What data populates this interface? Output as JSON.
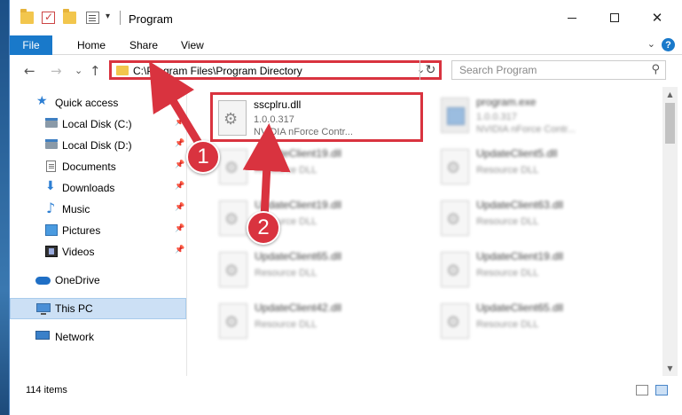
{
  "window": {
    "title": "Program",
    "controls": {
      "minimize": "—",
      "maximize": "☐",
      "close": "✕"
    }
  },
  "quick_access_toolbar": {
    "dropdown": "▾"
  },
  "ribbon": {
    "tabs": [
      "File",
      "Home",
      "Share",
      "View"
    ],
    "collapse_chevron": "⌄",
    "help": "?"
  },
  "navigation": {
    "back": "←",
    "forward": "→",
    "recent": "⌄",
    "up": "↑",
    "address": "C:\\Program Files\\Program Directory",
    "address_dropdown": "⌄",
    "refresh": "↻",
    "search_placeholder": "Search Program",
    "search_icon": "⚲"
  },
  "sidebar": {
    "pin_glyph": "📌",
    "items": [
      {
        "label": "Quick access",
        "icon": "star-icon",
        "pinned": false
      },
      {
        "label": "Local Disk (C:)",
        "icon": "drive-icon",
        "pinned": true
      },
      {
        "label": "Local Disk (D:)",
        "icon": "drive-icon",
        "pinned": true
      },
      {
        "label": "Documents",
        "icon": "documents-icon",
        "pinned": true
      },
      {
        "label": "Downloads",
        "icon": "downloads-icon",
        "pinned": true
      },
      {
        "label": "Music",
        "icon": "music-icon",
        "pinned": true
      },
      {
        "label": "Pictures",
        "icon": "pictures-icon",
        "pinned": true
      },
      {
        "label": "Videos",
        "icon": "videos-icon",
        "pinned": true
      },
      {
        "label": "OneDrive",
        "icon": "onedrive-icon",
        "pinned": false
      },
      {
        "label": "This PC",
        "icon": "this-pc-icon",
        "pinned": false,
        "selected": true
      },
      {
        "label": "Network",
        "icon": "network-icon",
        "pinned": false
      }
    ]
  },
  "files": [
    {
      "name": "sscplru.dll",
      "version": "1.0.0.317",
      "description": "NVIDIA nForce Contr...",
      "highlighted": true
    },
    {
      "name": "program.exe",
      "version": "1.0.0.317",
      "description": "NVIDIA nForce Contr..."
    },
    {
      "name": "UpdateClient19.dll",
      "version": "",
      "description": "Resource DLL"
    },
    {
      "name": "UpdateClient5.dll",
      "version": "",
      "description": "Resource DLL"
    },
    {
      "name": "UpdateClient19.dll",
      "version": "",
      "description": "Resource DLL"
    },
    {
      "name": "UpdateClient63.dll",
      "version": "",
      "description": "Resource DLL"
    },
    {
      "name": "UpdateClient65.dll",
      "version": "",
      "description": "Resource DLL"
    },
    {
      "name": "UpdateClient19.dll",
      "version": "",
      "description": "Resource DLL"
    },
    {
      "name": "UpdateClient42.dll",
      "version": "",
      "description": "Resource DLL"
    },
    {
      "name": "UpdateClient65.dll",
      "version": "",
      "description": "Resource DLL"
    }
  ],
  "scrollbar": {
    "up": "▲",
    "down": "▼"
  },
  "status": {
    "item_count": "114 items"
  },
  "annotations": {
    "badge1": "1",
    "badge2": "2",
    "color": "#d9333f"
  }
}
